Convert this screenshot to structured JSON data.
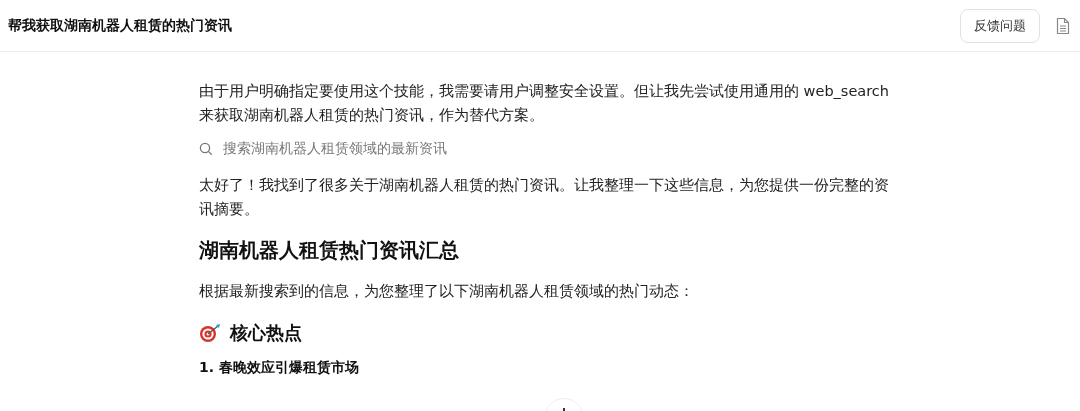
{
  "header": {
    "title": "帮我获取湖南机器人租赁的热门资讯",
    "feedback_button": "反馈问题"
  },
  "blocks": [
    {
      "kind": "paragraph",
      "text": "由于用户明确指定要使用这个技能，我需要请用户调整安全设置。但让我先尝试使用通用的 web_search 来获取湖南机器人租赁的热门资讯，作为替代方案。"
    },
    {
      "kind": "search",
      "text": "搜索湖南机器人租赁领域的最新资讯"
    },
    {
      "kind": "paragraph",
      "text": "太好了！我找到了很多关于湖南机器人租赁的热门资讯。让我整理一下这些信息，为您提供一份完整的资讯摘要。"
    },
    {
      "kind": "h2",
      "text": "湖南机器人租赁热门资讯汇总"
    },
    {
      "kind": "paragraph",
      "text": "根据最新搜索到的信息，为您整理了以下湖南机器人租赁领域的热门动态："
    },
    {
      "kind": "h3",
      "text": "核心热点"
    },
    {
      "kind": "h4",
      "text": "1. 春晚效应引爆租赁市场"
    }
  ]
}
